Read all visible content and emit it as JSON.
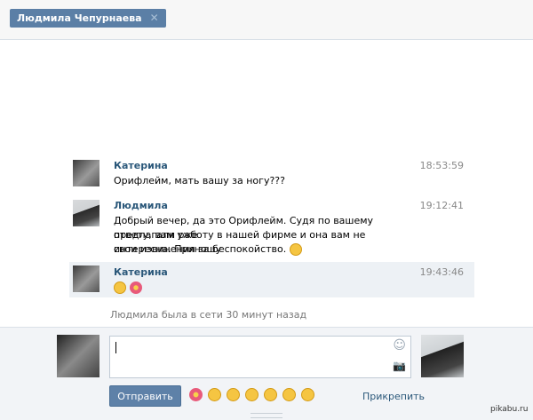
{
  "tab": {
    "title": "Людмила Чепурнаева",
    "close_glyph": "✕"
  },
  "messages": [
    {
      "author": "Катерина",
      "time": "18:53:59",
      "lines": [
        "Орифлейм, мать вашу за ногу???"
      ]
    },
    {
      "author": "Людмила",
      "time": "19:12:41",
      "lines": [
        "Добрый вечер, да это Орифлейм. Судя по вашему ответу, вам уже",
        "предлагали работу в нашей фирме и она вам не интересна. Приношу",
        "свои извинения за беспокойство."
      ]
    },
    {
      "author": "Катерина",
      "time": "19:43:46",
      "lines": []
    }
  ],
  "status": "Людмила была в сети 30 минут назад",
  "composer": {
    "send_label": "Отправить",
    "attach_label": "Прикрепить",
    "smile_icon": "☺",
    "camera_icon": "📷"
  },
  "watermark": "pikabu.ru",
  "colors": {
    "accent": "#5b7fa6",
    "author": "#2b587a",
    "highlight": "#edf1f5"
  }
}
